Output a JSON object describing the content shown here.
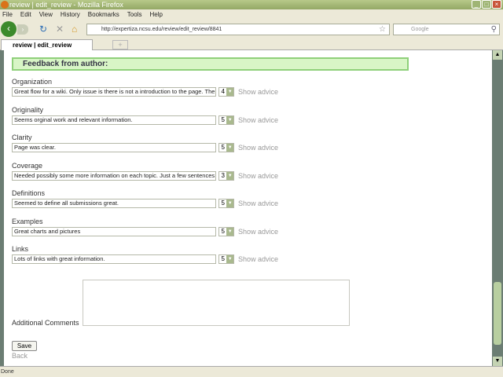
{
  "window": {
    "title": "review | edit_review - Mozilla Firefox"
  },
  "menu": [
    "File",
    "Edit",
    "View",
    "History",
    "Bookmarks",
    "Tools",
    "Help"
  ],
  "nav": {
    "url": "http://expertiza.ncsu.edu/review/edit_review/8841",
    "search_placeholder": "Google"
  },
  "tabs": [
    {
      "label": "review | edit_review"
    }
  ],
  "feedback": {
    "heading": "Feedback from author:"
  },
  "questions": [
    {
      "label": "Organization",
      "comment": "Great flow for a wiki. Only issue is there is not a introduction to the page. The",
      "score": "4",
      "advice": "Show advice"
    },
    {
      "label": "Originality",
      "comment": "Seems orginal work and relevant information.",
      "score": "5",
      "advice": "Show advice"
    },
    {
      "label": "Clarity",
      "comment": "Page was clear.",
      "score": "5",
      "advice": "Show advice"
    },
    {
      "label": "Coverage",
      "comment": "Needed possibly some more information on each topic. Just a few sentences",
      "score": "3",
      "advice": "Show advice"
    },
    {
      "label": "Definitions",
      "comment": "Seemed to define all submissions great.",
      "score": "5",
      "advice": "Show advice"
    },
    {
      "label": "Examples",
      "comment": "Great charts and pictures",
      "score": "5",
      "advice": "Show advice"
    },
    {
      "label": "Links",
      "comment": "Lots of links with great information.",
      "score": "5",
      "advice": "Show advice"
    }
  ],
  "additional_comments": {
    "label": "Additional Comments",
    "value": ""
  },
  "save_label": "Save",
  "back_label": "Back",
  "status": "Done"
}
